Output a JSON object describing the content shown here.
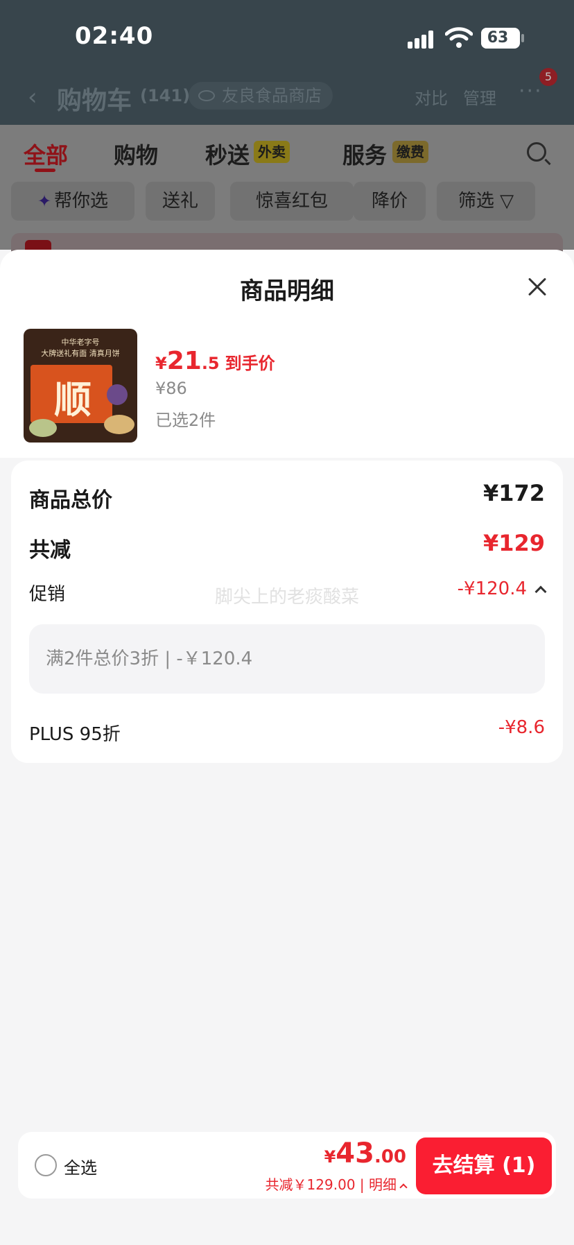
{
  "status_bar": {
    "time": "02:40",
    "battery": "63"
  },
  "nav": {
    "back_icon": "chevron-left-icon",
    "title": "购物车",
    "count": "(141)",
    "store": "友良食品商店",
    "compare": "对比",
    "manage": "管理",
    "more": "···",
    "msg_badge": "5"
  },
  "tabs": [
    {
      "label": "全部",
      "active": true
    },
    {
      "label": "购物"
    },
    {
      "label": "秒送",
      "tag": "外卖"
    },
    {
      "label": "服务",
      "tag": "缴费"
    }
  ],
  "chips": [
    "帮你选",
    "送礼",
    "惊喜红包",
    "降价",
    "筛选"
  ],
  "sheet": {
    "title": "商品明细",
    "product": {
      "image_text": [
        "中华老字号",
        "大牌送礼有面  清真月饼"
      ],
      "image_glyph": "顺",
      "price_currency": "¥",
      "price_int": "21",
      "price_dec": ".5",
      "price_label": "到手价",
      "original_price": "¥86",
      "selected_count": "已选2件"
    },
    "detail": {
      "total_label": "商品总价",
      "total_value": "¥172",
      "discount_label": "共减",
      "discount_value": "¥129",
      "promo_label": "促销",
      "promo_value": "-¥120.4",
      "promo_rule": "满2件总价3折 | -￥120.4",
      "plus_label": "PLUS 95折",
      "plus_value": "-¥8.6",
      "watermark": "脚尖上的老痰酸菜"
    }
  },
  "checkout": {
    "select_all": "全选",
    "total_currency": "¥",
    "total_int": "43",
    "total_dec": ".00",
    "saving": "共减￥129.00 | 明细",
    "button": "去结算 (1)"
  },
  "colors": {
    "accent_red": "#e8262e",
    "button_red": "#fa1e32"
  }
}
